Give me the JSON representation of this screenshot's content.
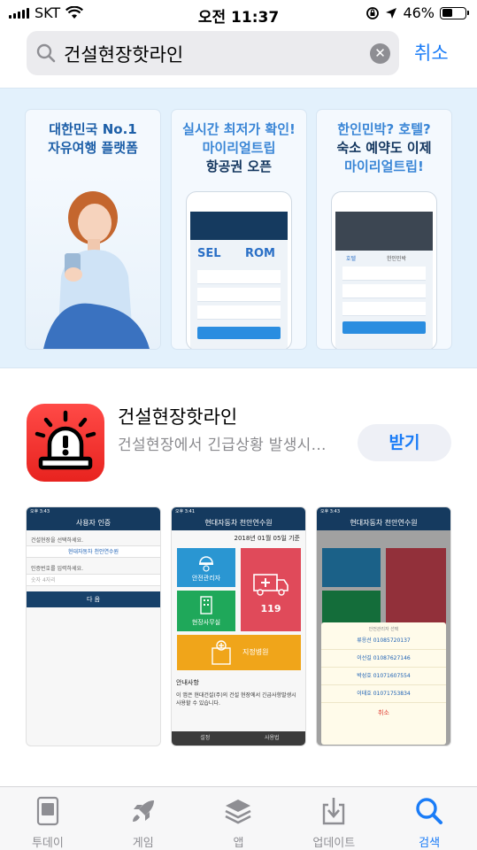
{
  "status_bar": {
    "carrier": "SKT",
    "time": "오전 11:37",
    "battery": "46%",
    "battery_level": 0.46
  },
  "search": {
    "query": "건설현장핫라인",
    "clear_icon": "clear-icon",
    "cancel_label": "취소"
  },
  "banner": {
    "cards": [
      {
        "lines": [
          "대한민국 No.1",
          "자유여행 플랫폼"
        ]
      },
      {
        "lines": [
          "실시간 최저가 확인!",
          "마이리얼트립",
          "항공권 오픈"
        ],
        "from": "SEL",
        "to": "ROM"
      },
      {
        "lines": [
          "한인민박? 호텔?",
          "숙소 예약도 이제",
          "마이리얼트립!"
        ],
        "tab1": "호텔",
        "tab2": "한인민박"
      }
    ]
  },
  "app": {
    "name": "건설현장핫라인",
    "subtitle": "건설현장에서 긴급상황 발생시...",
    "get_label": "받기"
  },
  "screenshots": {
    "s1": {
      "time": "오후 3:43",
      "title": "사용자 인증",
      "select_label": "건설현장을 선택하세요.",
      "select_value": "현대자동차 천안연수원",
      "code_label": "인증번호를 입력하세요.",
      "code_placeholder": "숫자 4자리",
      "next": "다 음"
    },
    "s2": {
      "time": "오후 3:41",
      "title": "현대자동차 천안연수원",
      "date": "2018년 01월 05일 기준",
      "tile_safety": "안전관리자",
      "tile_119": "119",
      "tile_office": "현장사무실",
      "tile_hospital": "지정병원",
      "notice_title": "안내사항",
      "notice_body": "이 앱은 현대건설(주)의 건설 현장에서 긴급사항발생시 사용할 수 있습니다.",
      "foot_settings": "설정",
      "foot_manual": "사용법"
    },
    "s3": {
      "time": "오후 3:43",
      "title": "현대자동차 천안연수원",
      "sheet_title": "안전관리자 선택",
      "items": [
        "류응선 01085720137",
        "이선길 01087627146",
        "박성호 01071607554",
        "이태호 01071753834"
      ],
      "cancel": "취소"
    }
  },
  "tab_bar": {
    "tabs": [
      {
        "label": "투데이",
        "icon": "today-icon"
      },
      {
        "label": "게임",
        "icon": "rocket-icon"
      },
      {
        "label": "앱",
        "icon": "layers-icon"
      },
      {
        "label": "업데이트",
        "icon": "update-icon"
      },
      {
        "label": "검색",
        "icon": "search-icon"
      }
    ],
    "active": "검색"
  },
  "colors": {
    "accent": "#1a7cf7",
    "app_icon": "#f02a27",
    "banner_bg": "#e3f1fc",
    "navy": "#153a5f"
  }
}
